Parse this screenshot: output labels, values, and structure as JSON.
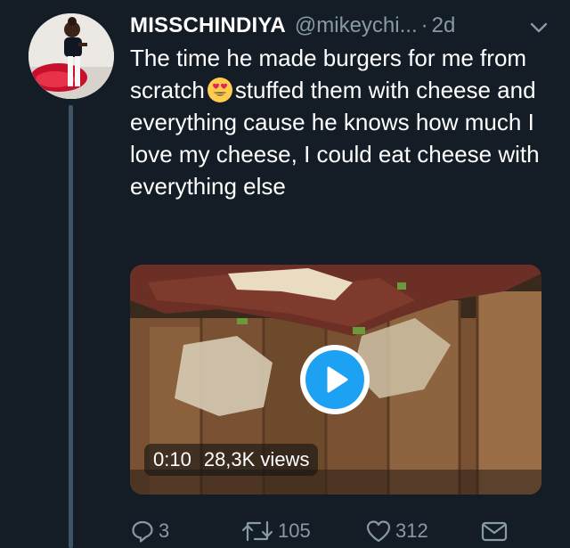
{
  "tweet": {
    "display_name": "MISSCHINDIYA",
    "handle": "@mikeychi...",
    "separator": "·",
    "time": "2d",
    "text_before_emoji": "The time he made burgers for me from scratch",
    "emoji_name": "heart-eyes-emoji",
    "text_after_emoji": "stuffed them with cheese and everything cause he knows how much I love my cheese, I could eat cheese with everything else"
  },
  "video": {
    "duration": "0:10",
    "views": "28,3K views"
  },
  "actions": {
    "reply_count": "3",
    "retweet_count": "105",
    "like_count": "312"
  },
  "colors": {
    "background": "#141d26",
    "secondary_text": "#8899a6",
    "play_blue": "#1da1f2",
    "thread_line": "#3d5466"
  },
  "icons": [
    "chevron-down-icon",
    "play-icon",
    "reply-icon",
    "retweet-icon",
    "like-icon",
    "direct-message-icon"
  ]
}
